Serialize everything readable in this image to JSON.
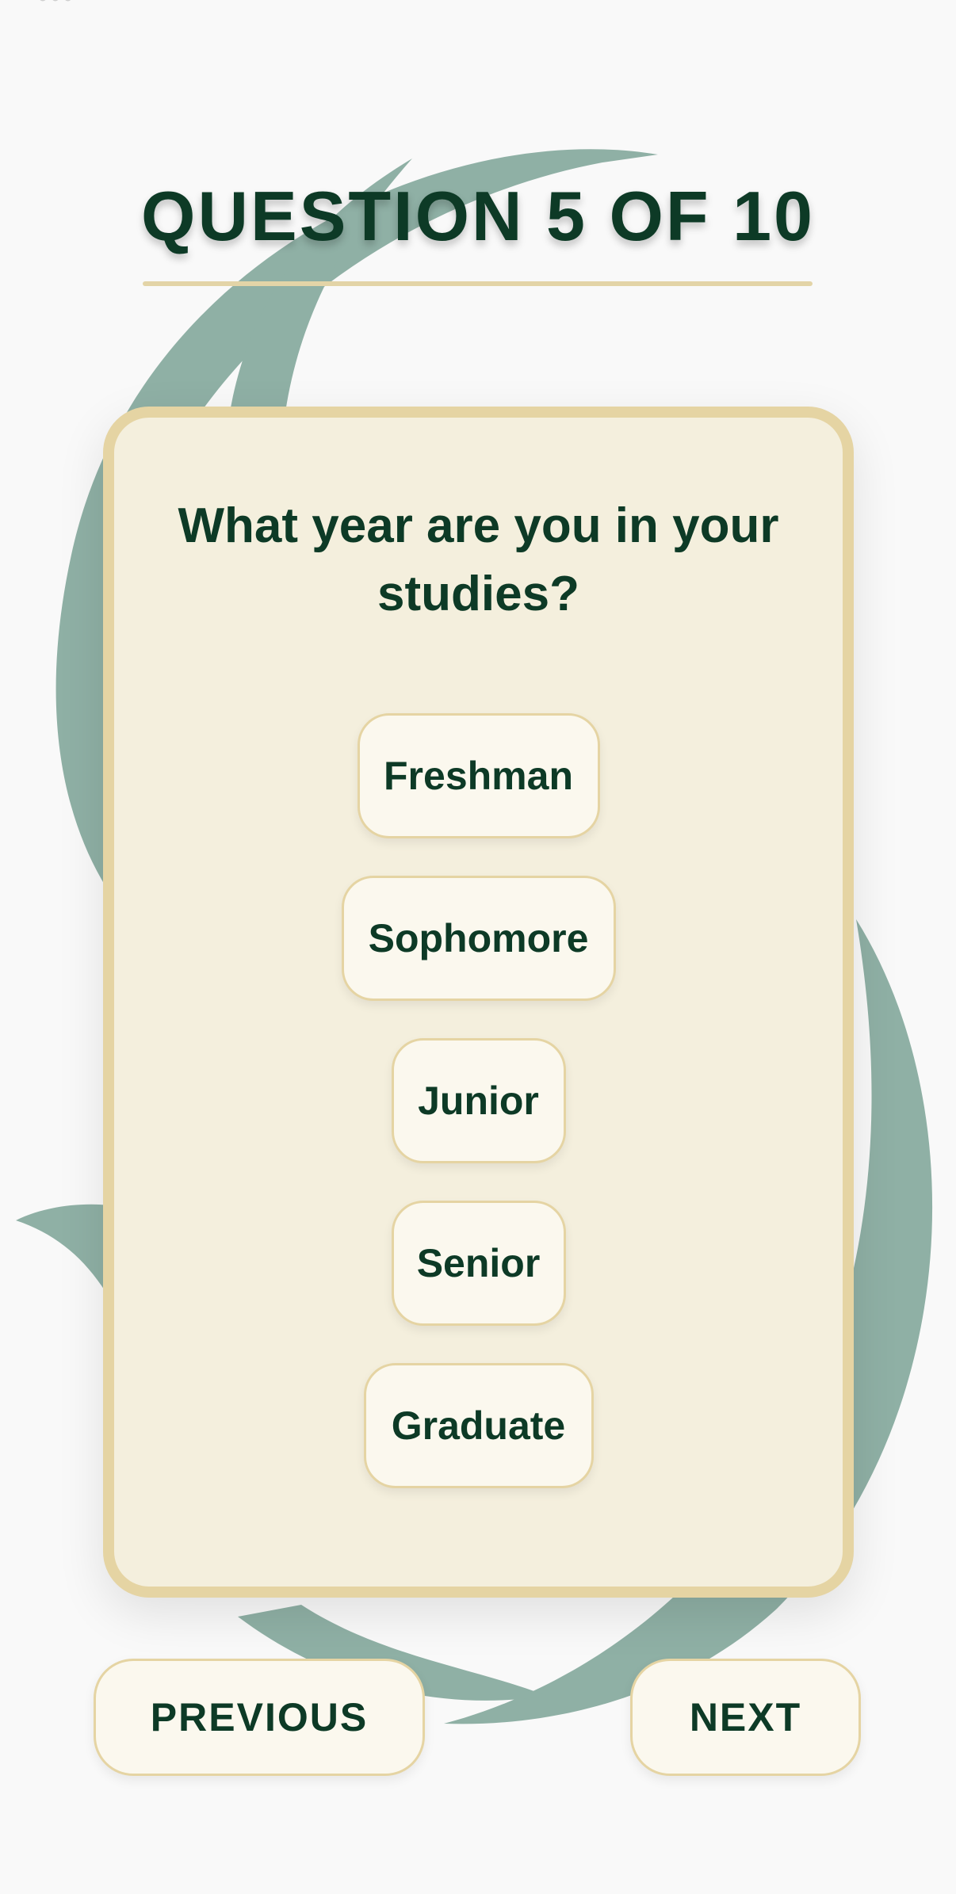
{
  "header": {
    "title": "QUESTION 5 OF 10"
  },
  "question": {
    "text": "What year are you in your studies?",
    "options": [
      {
        "label": "Freshman"
      },
      {
        "label": "Sophomore"
      },
      {
        "label": "Junior"
      },
      {
        "label": "Senior"
      },
      {
        "label": "Graduate"
      }
    ]
  },
  "navigation": {
    "previous_label": "PREVIOUS",
    "next_label": "NEXT"
  },
  "colors": {
    "background": "#f9f9f9",
    "primary_text": "#0d3a26",
    "card_background": "#f4efdd",
    "card_border": "#e5d4a3",
    "button_background": "#fbf8ee",
    "decor_green": "#8fb0a5"
  }
}
